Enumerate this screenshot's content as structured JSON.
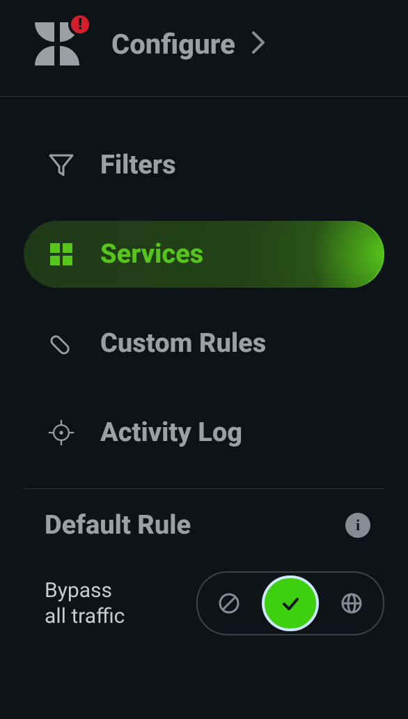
{
  "header": {
    "title": "Configure",
    "alert": "!"
  },
  "nav": {
    "items": [
      {
        "id": "filters",
        "label": "Filters",
        "active": false
      },
      {
        "id": "services",
        "label": "Services",
        "active": true
      },
      {
        "id": "custom-rules",
        "label": "Custom Rules",
        "active": false
      },
      {
        "id": "activity-log",
        "label": "Activity Log",
        "active": false
      }
    ]
  },
  "default_rule": {
    "title": "Default Rule",
    "info": "i",
    "option_label_line1": "Bypass",
    "option_label_line2": "all traffic",
    "selected": "allow"
  }
}
